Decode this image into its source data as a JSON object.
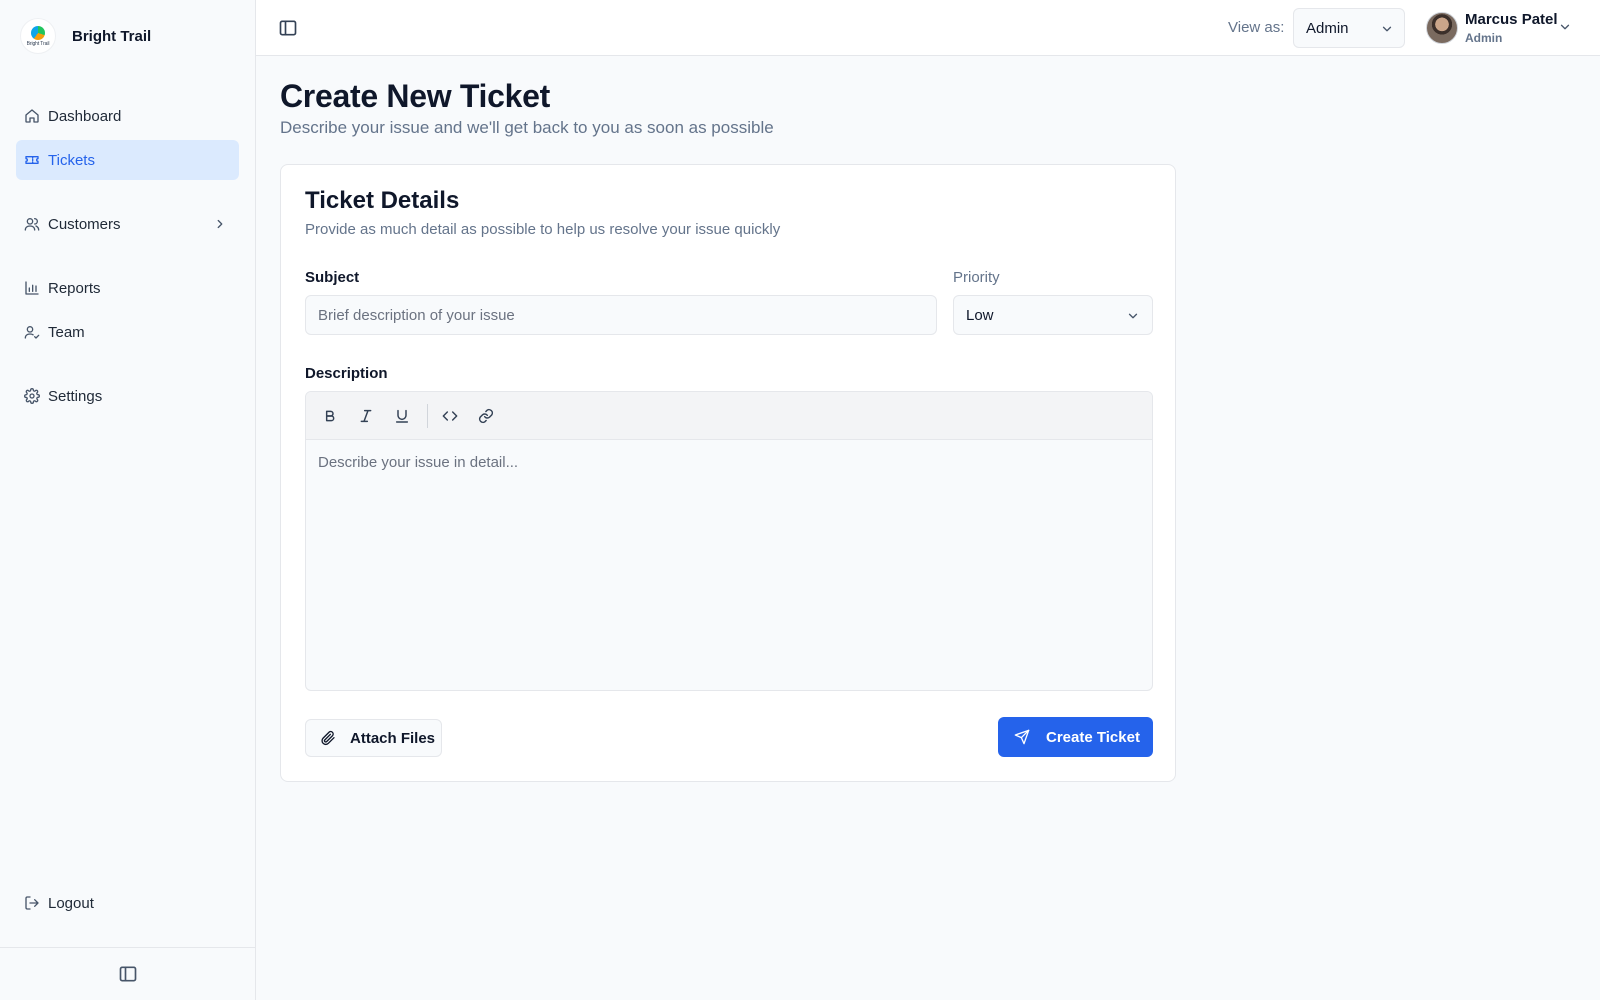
{
  "brand": {
    "name": "Bright Trail",
    "logo_text": "Bright Trail"
  },
  "sidebar": {
    "items": [
      {
        "label": "Dashboard",
        "icon": "home-icon"
      },
      {
        "label": "Tickets",
        "icon": "ticket-icon",
        "active": true
      },
      {
        "label": "Customers",
        "icon": "users-icon",
        "has_submenu": true
      },
      {
        "label": "Reports",
        "icon": "bar-chart-icon"
      },
      {
        "label": "Team",
        "icon": "user-check-icon"
      },
      {
        "label": "Settings",
        "icon": "gear-icon"
      }
    ],
    "logout_label": "Logout"
  },
  "topbar": {
    "view_as_label": "View as:",
    "view_as_value": "Admin",
    "user": {
      "name": "Marcus Patel",
      "role": "Admin"
    }
  },
  "page": {
    "title": "Create New Ticket",
    "subtitle": "Describe your issue and we'll get back to you as soon as possible"
  },
  "card": {
    "title": "Ticket Details",
    "subtitle": "Provide as much detail as possible to help us resolve your issue quickly",
    "subject_label": "Subject",
    "subject_placeholder": "Brief description of your issue",
    "subject_value": "",
    "priority_label": "Priority",
    "priority_value": "Low",
    "description_label": "Description",
    "description_placeholder": "Describe your issue in detail...",
    "toolbar": [
      "bold-icon",
      "italic-icon",
      "underline-icon",
      "code-icon",
      "link-icon"
    ],
    "attach_label": "Attach Files",
    "submit_label": "Create Ticket"
  },
  "colors": {
    "accent": "#2563eb",
    "active_bg": "#dbeafe",
    "muted_text": "#64748b"
  }
}
